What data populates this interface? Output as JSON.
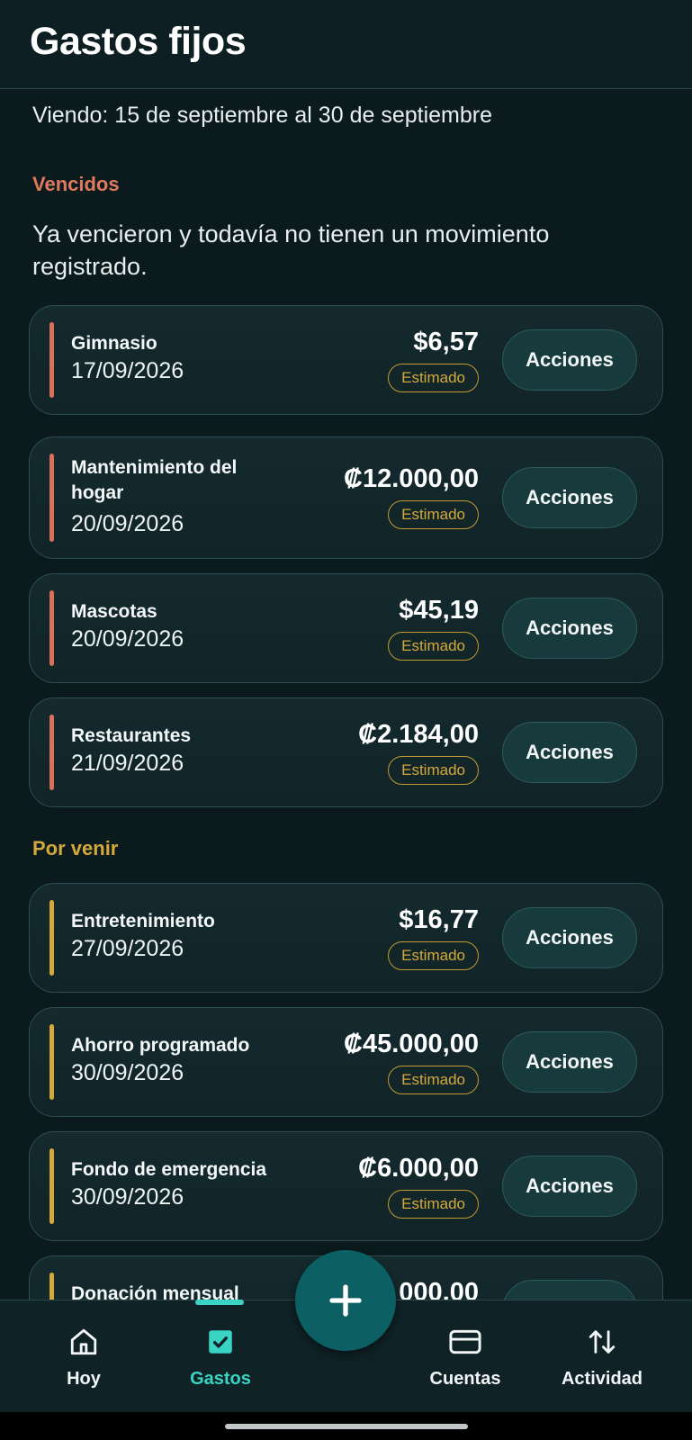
{
  "header": {
    "title": "Gastos fijos"
  },
  "range_text": "Viendo: 15 de septiembre al 30 de septiembre",
  "overdue": {
    "title": "Vencidos",
    "description": "Ya vencieron y todavía no tienen un movimiento registrado.",
    "items": [
      {
        "name": "Gimnasio",
        "date": "17/09/2026",
        "amount": "$6,57",
        "badge": "Estimado",
        "action": "Acciones"
      },
      {
        "name": "Mantenimiento del hogar",
        "date": "20/09/2026",
        "amount": "₡12.000,00",
        "badge": "Estimado",
        "action": "Acciones"
      },
      {
        "name": "Mascotas",
        "date": "20/09/2026",
        "amount": "$45,19",
        "badge": "Estimado",
        "action": "Acciones"
      },
      {
        "name": "Restaurantes",
        "date": "21/09/2026",
        "amount": "₡2.184,00",
        "badge": "Estimado",
        "action": "Acciones"
      }
    ]
  },
  "upcoming": {
    "title": "Por venir",
    "items": [
      {
        "name": "Entretenimiento",
        "date": "27/09/2026",
        "amount": "$16,77",
        "badge": "Estimado",
        "action": "Acciones"
      },
      {
        "name": "Ahorro programado",
        "date": "30/09/2026",
        "amount": "₡45.000,00",
        "badge": "Estimado",
        "action": "Acciones"
      },
      {
        "name": "Fondo de emergencia",
        "date": "30/09/2026",
        "amount": "₡6.000,00",
        "badge": "Estimado",
        "action": "Acciones"
      },
      {
        "name": "Donación mensual",
        "amount": "000,00"
      }
    ]
  },
  "nav": {
    "items": [
      {
        "label": "Hoy",
        "icon": "home-icon"
      },
      {
        "label": "Gastos",
        "icon": "checkbox-icon",
        "active": true
      },
      {
        "label": "Cuentas",
        "icon": "credit-card-icon"
      },
      {
        "label": "Actividad",
        "icon": "transfer-arrows-icon"
      }
    ],
    "fab_icon": "plus-icon"
  },
  "colors": {
    "background": "#0b1a1d",
    "overdue_accent": "#e07a5f",
    "upcoming_accent": "#d4a93c",
    "active_accent": "#3ad4c4",
    "fab": "#0c5f63"
  }
}
